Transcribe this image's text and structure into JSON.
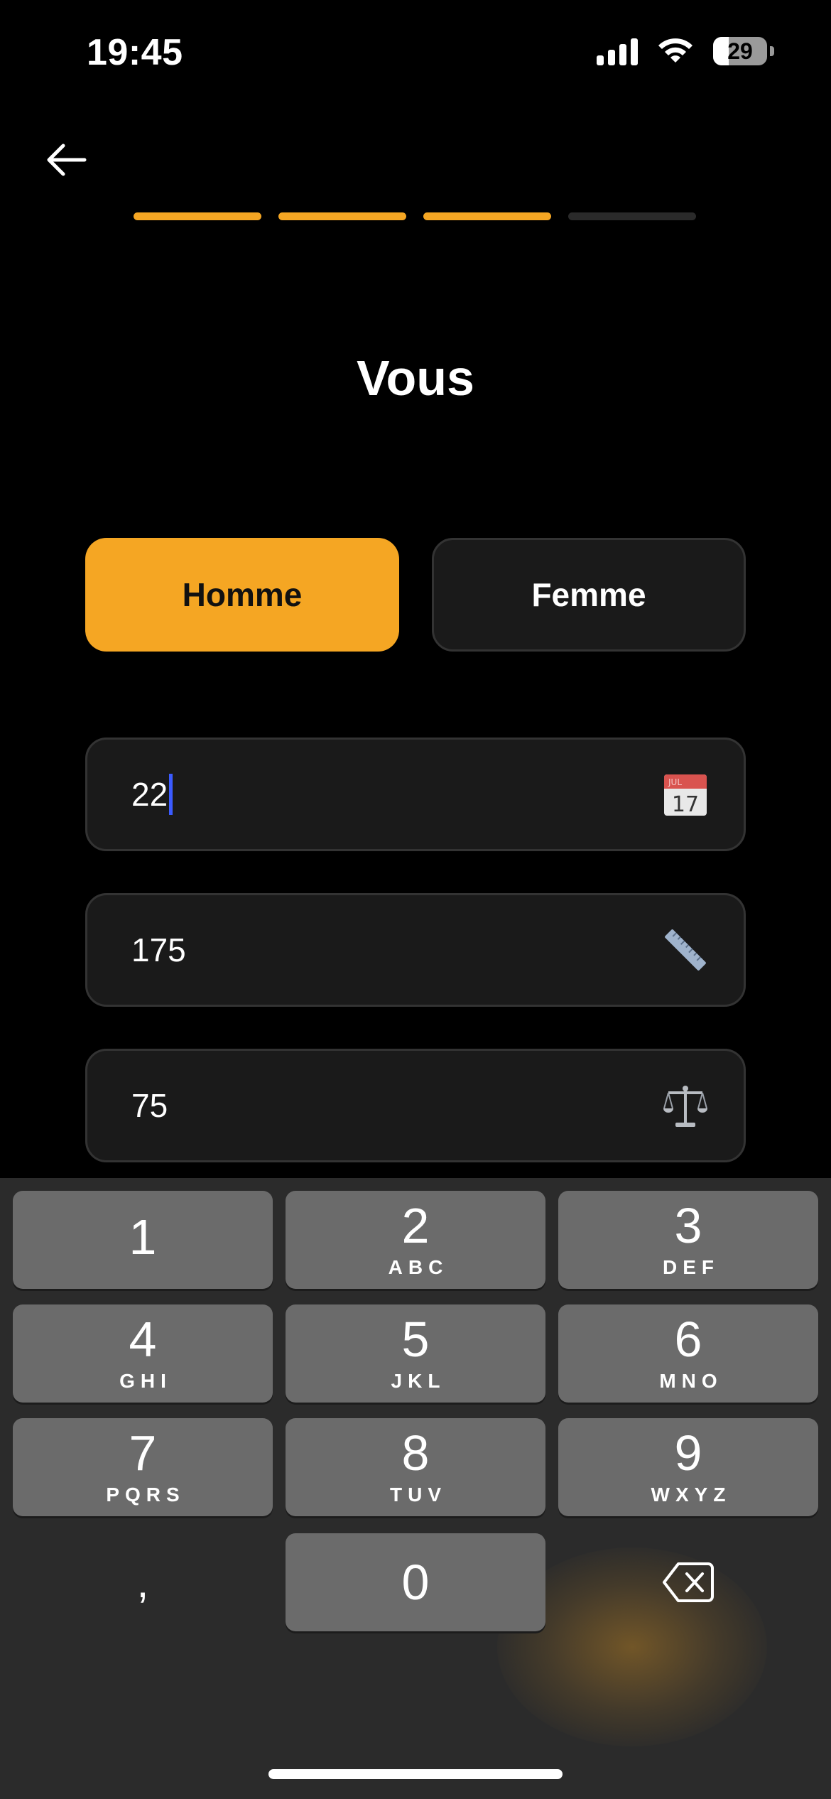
{
  "status_bar": {
    "time": "19:45",
    "battery": "29",
    "battery_level": 0.29
  },
  "colors": {
    "accent": "#f5a623",
    "background": "#000000",
    "field_bg": "#1a1a1a",
    "caret": "#3b5bff"
  },
  "progress": {
    "total_steps": 4,
    "completed_steps": 3
  },
  "title": "Vous",
  "gender": {
    "male_label": "Homme",
    "female_label": "Femme",
    "selected": "Homme"
  },
  "fields": {
    "age": {
      "value": "22",
      "icon": "calendar-icon",
      "focused": true
    },
    "height": {
      "value": "175",
      "icon": "ruler-icon"
    },
    "weight": {
      "value": "75",
      "icon": "scale-icon"
    }
  },
  "keyboard": {
    "keys": [
      {
        "num": "1",
        "letters": ""
      },
      {
        "num": "2",
        "letters": "ABC"
      },
      {
        "num": "3",
        "letters": "DEF"
      },
      {
        "num": "4",
        "letters": "GHI"
      },
      {
        "num": "5",
        "letters": "JKL"
      },
      {
        "num": "6",
        "letters": "MNO"
      },
      {
        "num": "7",
        "letters": "PQRS"
      },
      {
        "num": "8",
        "letters": "TUV"
      },
      {
        "num": "9",
        "letters": "WXYZ"
      },
      {
        "num": "0",
        "letters": ""
      }
    ],
    "decimal": ",",
    "delete_icon": "backspace-icon"
  }
}
